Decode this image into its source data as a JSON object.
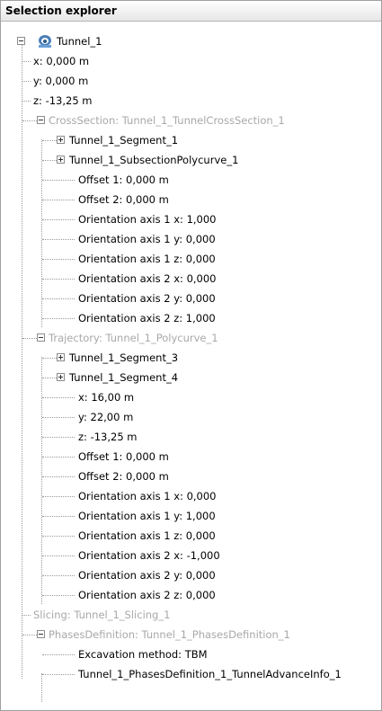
{
  "panel": {
    "title": "Selection explorer"
  },
  "root": {
    "label": "Tunnel_1",
    "icon": "tunnel-icon",
    "props": [
      "x: 0,000 m",
      "y: 0,000 m",
      "z: -13,25 m"
    ]
  },
  "cross_section": {
    "label": "CrossSection: Tunnel_1_TunnelCrossSection_1",
    "segments": [
      "Tunnel_1_Segment_1",
      "Tunnel_1_SubsectionPolycurve_1"
    ],
    "props": [
      "Offset 1: 0,000 m",
      "Offset 2: 0,000 m",
      "Orientation axis 1 x: 1,000",
      "Orientation axis 1 y: 0,000",
      "Orientation axis 1 z: 0,000",
      "Orientation axis 2 x: 0,000",
      "Orientation axis 2 y: 0,000",
      "Orientation axis 2 z: 1,000"
    ]
  },
  "trajectory": {
    "label": "Trajectory: Tunnel_1_Polycurve_1",
    "segments": [
      "Tunnel_1_Segment_3",
      "Tunnel_1_Segment_4"
    ],
    "props": [
      "x: 16,00 m",
      "y: 22,00 m",
      "z: -13,25 m",
      "Offset 1: 0,000 m",
      "Offset 2: 0,000 m",
      "Orientation axis 1 x: 0,000",
      "Orientation axis 1 y: 1,000",
      "Orientation axis 1 z: 0,000",
      "Orientation axis 2 x: -1,000",
      "Orientation axis 2 y: 0,000",
      "Orientation axis 2 z: 0,000"
    ]
  },
  "slicing": {
    "label": "Slicing: Tunnel_1_Slicing_1"
  },
  "phases": {
    "label": "PhasesDefinition: Tunnel_1_PhasesDefinition_1",
    "props": [
      "Excavation method: TBM",
      "Tunnel_1_PhasesDefinition_1_TunnelAdvanceInfo_1"
    ]
  }
}
